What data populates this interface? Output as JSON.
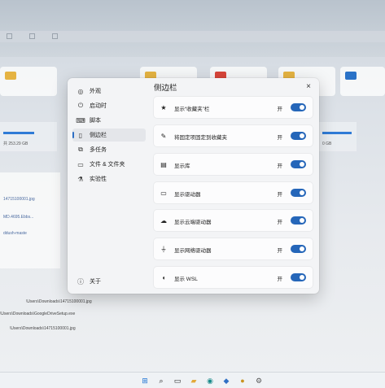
{
  "dialog": {
    "title": "侧边栏",
    "close_glyph": "×",
    "nav": [
      {
        "label": "外观",
        "icon": "palette-icon"
      },
      {
        "label": "启动时",
        "icon": "power-icon"
      },
      {
        "label": "脚本",
        "icon": "script-icon"
      },
      {
        "label": "侧边栏",
        "icon": "sidebar-icon",
        "selected": true
      },
      {
        "label": "多任务",
        "icon": "multitask-icon"
      },
      {
        "label": "文件 & 文件夹",
        "icon": "folder-icon"
      },
      {
        "label": "实验性",
        "icon": "flask-icon"
      }
    ],
    "about_label": "关于",
    "rows": [
      {
        "label": "显示“收藏夹”栏",
        "icon": "star-icon",
        "state": "开",
        "on": true
      },
      {
        "label": "将固定项固定到收藏夹",
        "icon": "pin-icon",
        "state": "开",
        "on": true
      },
      {
        "label": "显示库",
        "icon": "library-icon",
        "state": "开",
        "on": true
      },
      {
        "label": "显示驱动器",
        "icon": "drive-icon",
        "state": "开",
        "on": true
      },
      {
        "label": "显示云端驱动器",
        "icon": "cloud-icon",
        "state": "开",
        "on": true
      },
      {
        "label": "显示网络驱动器",
        "icon": "network-drive-icon",
        "state": "开",
        "on": true
      },
      {
        "label": "显示 WSL",
        "icon": "wsl-icon",
        "state": "开",
        "on": true
      }
    ]
  },
  "background": {
    "drive_captions": [
      "共 253.29 GB",
      "0 GB"
    ],
    "files": [
      "14715100001.jpg",
      "MD.4695.Ebbs...",
      "ddush-maste"
    ],
    "recent": [
      "\\Users\\Downloads\\14715100001.jpg",
      "\\Users\\Downloads\\GoogleDriveSetup.exe",
      "\\Users\\Downloads\\14715100001.jpg"
    ]
  },
  "colors": {
    "accent": "#2566b9",
    "dialog_bg": "#f3f4f6",
    "row_bg": "#fcfcfd"
  }
}
